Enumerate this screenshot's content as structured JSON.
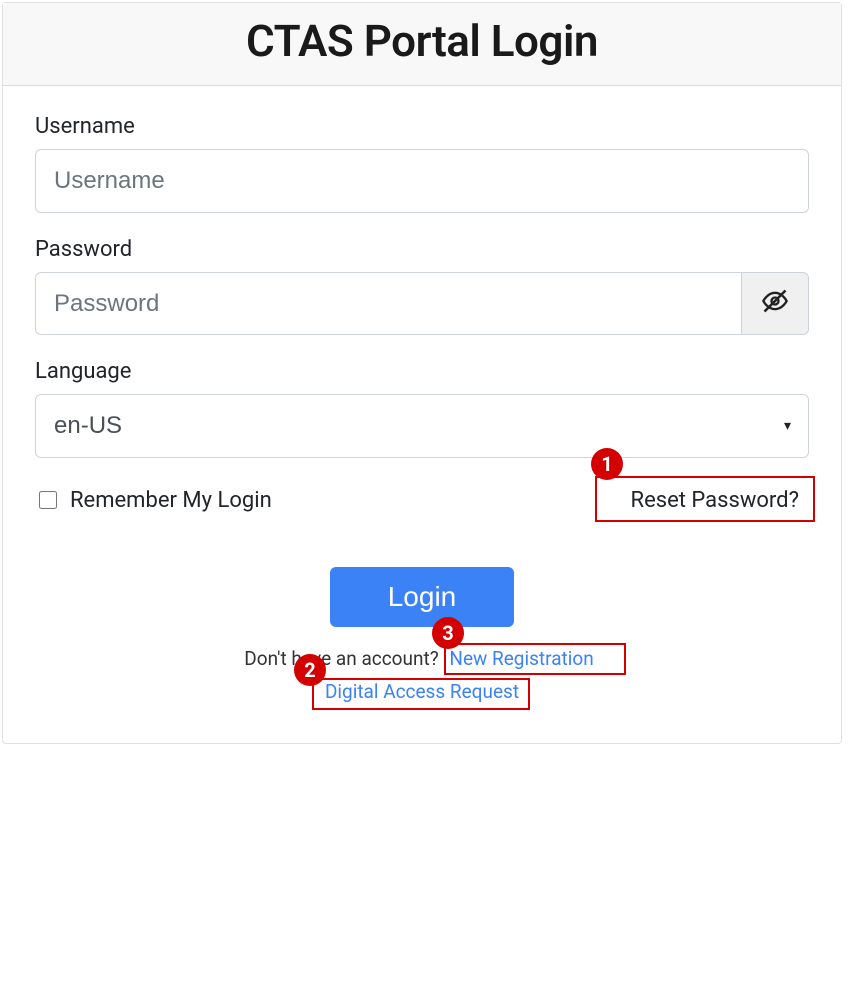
{
  "header": {
    "title": "CTAS Portal Login"
  },
  "form": {
    "username": {
      "label": "Username",
      "placeholder": "Username",
      "value": ""
    },
    "password": {
      "label": "Password",
      "placeholder": "Password",
      "value": ""
    },
    "language": {
      "label": "Language",
      "selected": "en-US"
    },
    "remember": {
      "label": "Remember My Login",
      "checked": false
    },
    "reset_link": "Reset Password?",
    "login_button": "Login",
    "no_account_text": "Don't have an account?",
    "new_registration_link": "New Registration",
    "digital_access_link": "Digital Access Request"
  },
  "annotations": {
    "badge1": "1",
    "badge2": "2",
    "badge3": "3"
  }
}
